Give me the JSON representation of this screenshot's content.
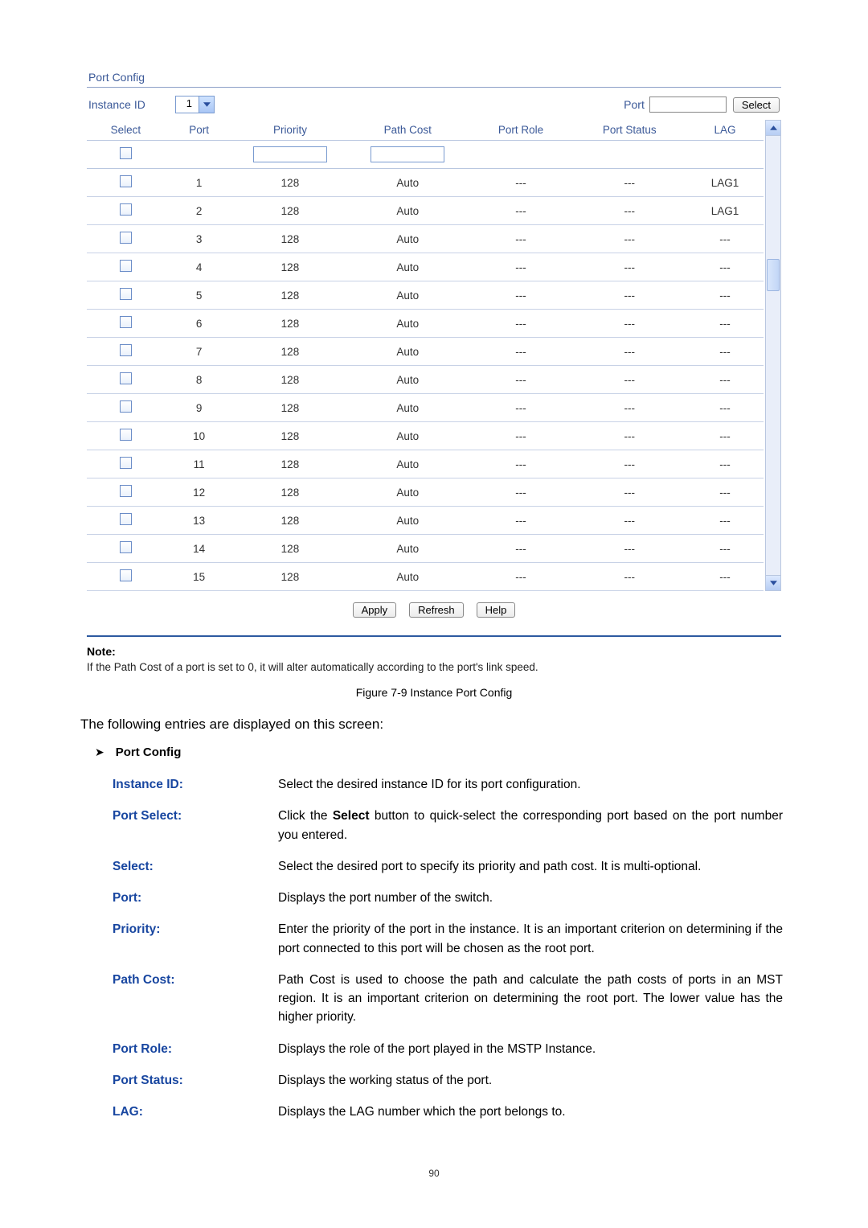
{
  "panel": {
    "title": "Port Config",
    "instance_label": "Instance ID",
    "instance_value": "1",
    "port_label": "Port",
    "port_input_value": "",
    "select_btn": "Select"
  },
  "columns": {
    "select": "Select",
    "port": "Port",
    "priority": "Priority",
    "path_cost": "Path Cost",
    "port_role": "Port Role",
    "port_status": "Port Status",
    "lag": "LAG"
  },
  "filter": {
    "priority_value": "",
    "path_cost_value": ""
  },
  "rows": [
    {
      "port": "1",
      "priority": "128",
      "path_cost": "Auto",
      "port_role": "---",
      "port_status": "---",
      "lag": "LAG1"
    },
    {
      "port": "2",
      "priority": "128",
      "path_cost": "Auto",
      "port_role": "---",
      "port_status": "---",
      "lag": "LAG1"
    },
    {
      "port": "3",
      "priority": "128",
      "path_cost": "Auto",
      "port_role": "---",
      "port_status": "---",
      "lag": "---"
    },
    {
      "port": "4",
      "priority": "128",
      "path_cost": "Auto",
      "port_role": "---",
      "port_status": "---",
      "lag": "---"
    },
    {
      "port": "5",
      "priority": "128",
      "path_cost": "Auto",
      "port_role": "---",
      "port_status": "---",
      "lag": "---"
    },
    {
      "port": "6",
      "priority": "128",
      "path_cost": "Auto",
      "port_role": "---",
      "port_status": "---",
      "lag": "---"
    },
    {
      "port": "7",
      "priority": "128",
      "path_cost": "Auto",
      "port_role": "---",
      "port_status": "---",
      "lag": "---"
    },
    {
      "port": "8",
      "priority": "128",
      "path_cost": "Auto",
      "port_role": "---",
      "port_status": "---",
      "lag": "---"
    },
    {
      "port": "9",
      "priority": "128",
      "path_cost": "Auto",
      "port_role": "---",
      "port_status": "---",
      "lag": "---"
    },
    {
      "port": "10",
      "priority": "128",
      "path_cost": "Auto",
      "port_role": "---",
      "port_status": "---",
      "lag": "---"
    },
    {
      "port": "11",
      "priority": "128",
      "path_cost": "Auto",
      "port_role": "---",
      "port_status": "---",
      "lag": "---"
    },
    {
      "port": "12",
      "priority": "128",
      "path_cost": "Auto",
      "port_role": "---",
      "port_status": "---",
      "lag": "---"
    },
    {
      "port": "13",
      "priority": "128",
      "path_cost": "Auto",
      "port_role": "---",
      "port_status": "---",
      "lag": "---"
    },
    {
      "port": "14",
      "priority": "128",
      "path_cost": "Auto",
      "port_role": "---",
      "port_status": "---",
      "lag": "---"
    },
    {
      "port": "15",
      "priority": "128",
      "path_cost": "Auto",
      "port_role": "---",
      "port_status": "---",
      "lag": "---"
    }
  ],
  "actions": {
    "apply": "Apply",
    "refresh": "Refresh",
    "help": "Help"
  },
  "note": {
    "title": "Note:",
    "text": "If the Path Cost of a port is set to 0, it will alter automatically according to the port's link speed."
  },
  "figure_caption": "Figure 7-9 Instance Port Config",
  "intro": "The following entries are displayed on this screen:",
  "section_heading": "Port Config",
  "defs": {
    "instance_id": {
      "term": "Instance ID:",
      "desc": "Select the desired instance ID for its port configuration."
    },
    "port_select": {
      "term": "Port Select:",
      "desc_pre": "Click the ",
      "desc_bold": "Select",
      "desc_post": " button to quick-select the corresponding port based on the port number you entered."
    },
    "select": {
      "term": "Select:",
      "desc": "Select the desired port to specify its priority and path cost. It is multi-optional."
    },
    "port": {
      "term": "Port:",
      "desc": "Displays the port number of the switch."
    },
    "priority": {
      "term": "Priority:",
      "desc": "Enter the priority of the port in the instance. It is an important criterion on determining if the port connected to this port will be chosen as the root port."
    },
    "path_cost": {
      "term": "Path Cost:",
      "desc": "Path Cost is used to choose the path and calculate the path costs of ports in an MST region. It is an important criterion on determining the root port. The lower value has the higher priority."
    },
    "port_role": {
      "term": "Port Role:",
      "desc": "Displays the role of the port played in the MSTP Instance."
    },
    "port_status": {
      "term": "Port Status:",
      "desc": "Displays the working status of the port."
    },
    "lag": {
      "term": "LAG:",
      "desc": "Displays the LAG number which the port belongs to."
    }
  },
  "page_number": "90"
}
